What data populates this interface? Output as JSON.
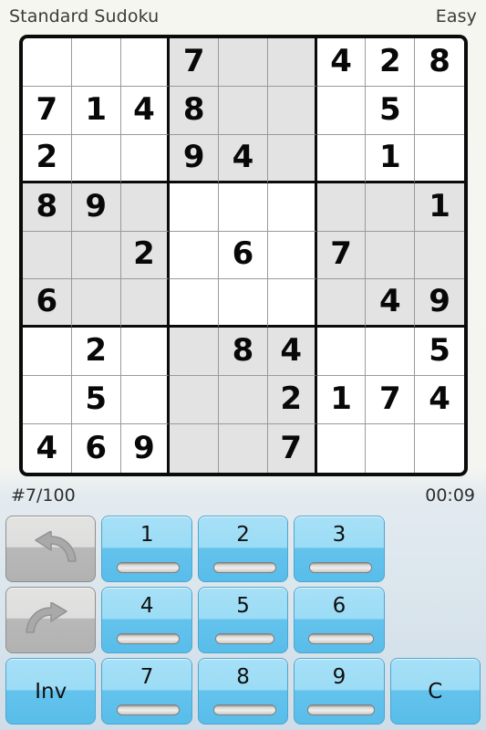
{
  "header": {
    "title": "Standard Sudoku",
    "difficulty": "Easy"
  },
  "status": {
    "puzzle_counter": "#7/100",
    "timer": "00:09"
  },
  "grid": {
    "rows": [
      [
        "",
        "",
        "",
        "7",
        "",
        "",
        "4",
        "2",
        "8"
      ],
      [
        "7",
        "1",
        "4",
        "8",
        "",
        "",
        "",
        "5",
        ""
      ],
      [
        "2",
        "",
        "",
        "9",
        "4",
        "",
        "",
        "1",
        ""
      ],
      [
        "8",
        "9",
        "",
        "",
        "",
        "",
        "",
        "",
        "1"
      ],
      [
        "",
        "",
        "2",
        "",
        "6",
        "",
        "7",
        "",
        ""
      ],
      [
        "6",
        "",
        "",
        "",
        "",
        "",
        "",
        "4",
        "9"
      ],
      [
        "",
        "2",
        "",
        "",
        "8",
        "4",
        "",
        "",
        "5"
      ],
      [
        "",
        "5",
        "",
        "",
        "",
        "2",
        "1",
        "7",
        "4"
      ],
      [
        "4",
        "6",
        "9",
        "",
        "",
        "7",
        "",
        "",
        ""
      ]
    ],
    "shaded_boxes": [
      1,
      3,
      5,
      7
    ],
    "colors": {
      "cell_background": "#ffffff",
      "cell_shaded_background": "#e3e3e3",
      "digit": "#080808",
      "thick_line": "#0b0b0b",
      "thin_line": "#9a9a9a"
    }
  },
  "keypad": {
    "rows": [
      [
        {
          "name": "undo",
          "type": "icon",
          "icon": "undo-arrow-icon",
          "label": ""
        },
        {
          "name": "1",
          "type": "number",
          "label": "1",
          "fill": 0.78
        },
        {
          "name": "2",
          "type": "number",
          "label": "2",
          "fill": 0.78
        },
        {
          "name": "3",
          "type": "number",
          "label": "3",
          "fill": 0.78
        },
        {
          "name": "spacer",
          "type": "empty",
          "label": ""
        }
      ],
      [
        {
          "name": "redo",
          "type": "icon",
          "icon": "redo-arrow-icon",
          "label": ""
        },
        {
          "name": "4",
          "type": "number",
          "label": "4",
          "fill": 0.78
        },
        {
          "name": "5",
          "type": "number",
          "label": "5",
          "fill": 0.74
        },
        {
          "name": "6",
          "type": "number",
          "label": "6",
          "fill": 0.82
        },
        {
          "name": "spacer",
          "type": "empty",
          "label": ""
        }
      ],
      [
        {
          "name": "inv",
          "type": "action",
          "label": "Inv",
          "fill": 0
        },
        {
          "name": "7",
          "type": "number",
          "label": "7",
          "fill": 0.78
        },
        {
          "name": "8",
          "type": "number",
          "label": "8",
          "fill": 0.78
        },
        {
          "name": "9",
          "type": "number",
          "label": "9",
          "fill": 0.84
        },
        {
          "name": "clear",
          "type": "action",
          "label": "C",
          "fill": 0
        }
      ]
    ],
    "colors": {
      "button_blue_top": "#a6e0f7",
      "button_blue_bottom": "#59bdea",
      "button_gray": "#d8d8d6",
      "capsule": "#efedea"
    }
  }
}
